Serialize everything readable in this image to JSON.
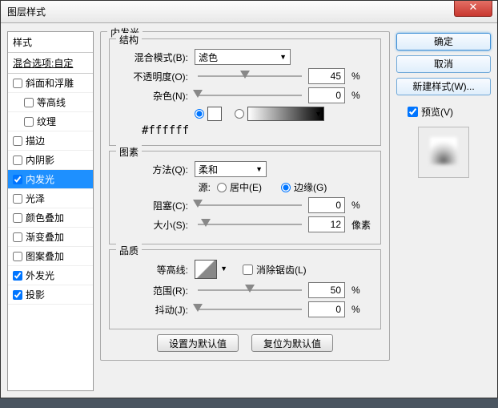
{
  "title": "图层样式",
  "left": {
    "header": "样式",
    "blend": "混合选项:自定",
    "items": [
      {
        "label": "斜面和浮雕",
        "checked": false,
        "indent": false
      },
      {
        "label": "等高线",
        "checked": false,
        "indent": true
      },
      {
        "label": "纹理",
        "checked": false,
        "indent": true
      },
      {
        "label": "描边",
        "checked": false,
        "indent": false
      },
      {
        "label": "内阴影",
        "checked": false,
        "indent": false
      },
      {
        "label": "内发光",
        "checked": true,
        "indent": false,
        "selected": true
      },
      {
        "label": "光泽",
        "checked": false,
        "indent": false
      },
      {
        "label": "颜色叠加",
        "checked": false,
        "indent": false
      },
      {
        "label": "渐变叠加",
        "checked": false,
        "indent": false
      },
      {
        "label": "图案叠加",
        "checked": false,
        "indent": false
      },
      {
        "label": "外发光",
        "checked": true,
        "indent": false
      },
      {
        "label": "投影",
        "checked": true,
        "indent": false
      }
    ]
  },
  "panel": {
    "title": "内发光",
    "structure": {
      "title": "结构",
      "blend_label": "混合模式(B):",
      "blend_value": "滤色",
      "opacity_label": "不透明度(O):",
      "opacity_value": "45",
      "opacity_unit": "%",
      "noise_label": "杂色(N):",
      "noise_value": "0",
      "noise_unit": "%",
      "hex": "#ffffff"
    },
    "elements": {
      "title": "图素",
      "technique_label": "方法(Q):",
      "technique_value": "柔和",
      "source_label": "源:",
      "center_label": "居中(E)",
      "edge_label": "边缘(G)",
      "choke_label": "阻塞(C):",
      "choke_value": "0",
      "choke_unit": "%",
      "size_label": "大小(S):",
      "size_value": "12",
      "size_unit": "像素"
    },
    "quality": {
      "title": "品质",
      "contour_label": "等高线:",
      "antialias_label": "消除锯齿(L)",
      "range_label": "范围(R):",
      "range_value": "50",
      "range_unit": "%",
      "jitter_label": "抖动(J):",
      "jitter_value": "0",
      "jitter_unit": "%"
    },
    "defaults_btn": "设置为默认值",
    "reset_btn": "复位为默认值"
  },
  "right": {
    "ok": "确定",
    "cancel": "取消",
    "newstyle": "新建样式(W)...",
    "preview_label": "预览(V)"
  }
}
